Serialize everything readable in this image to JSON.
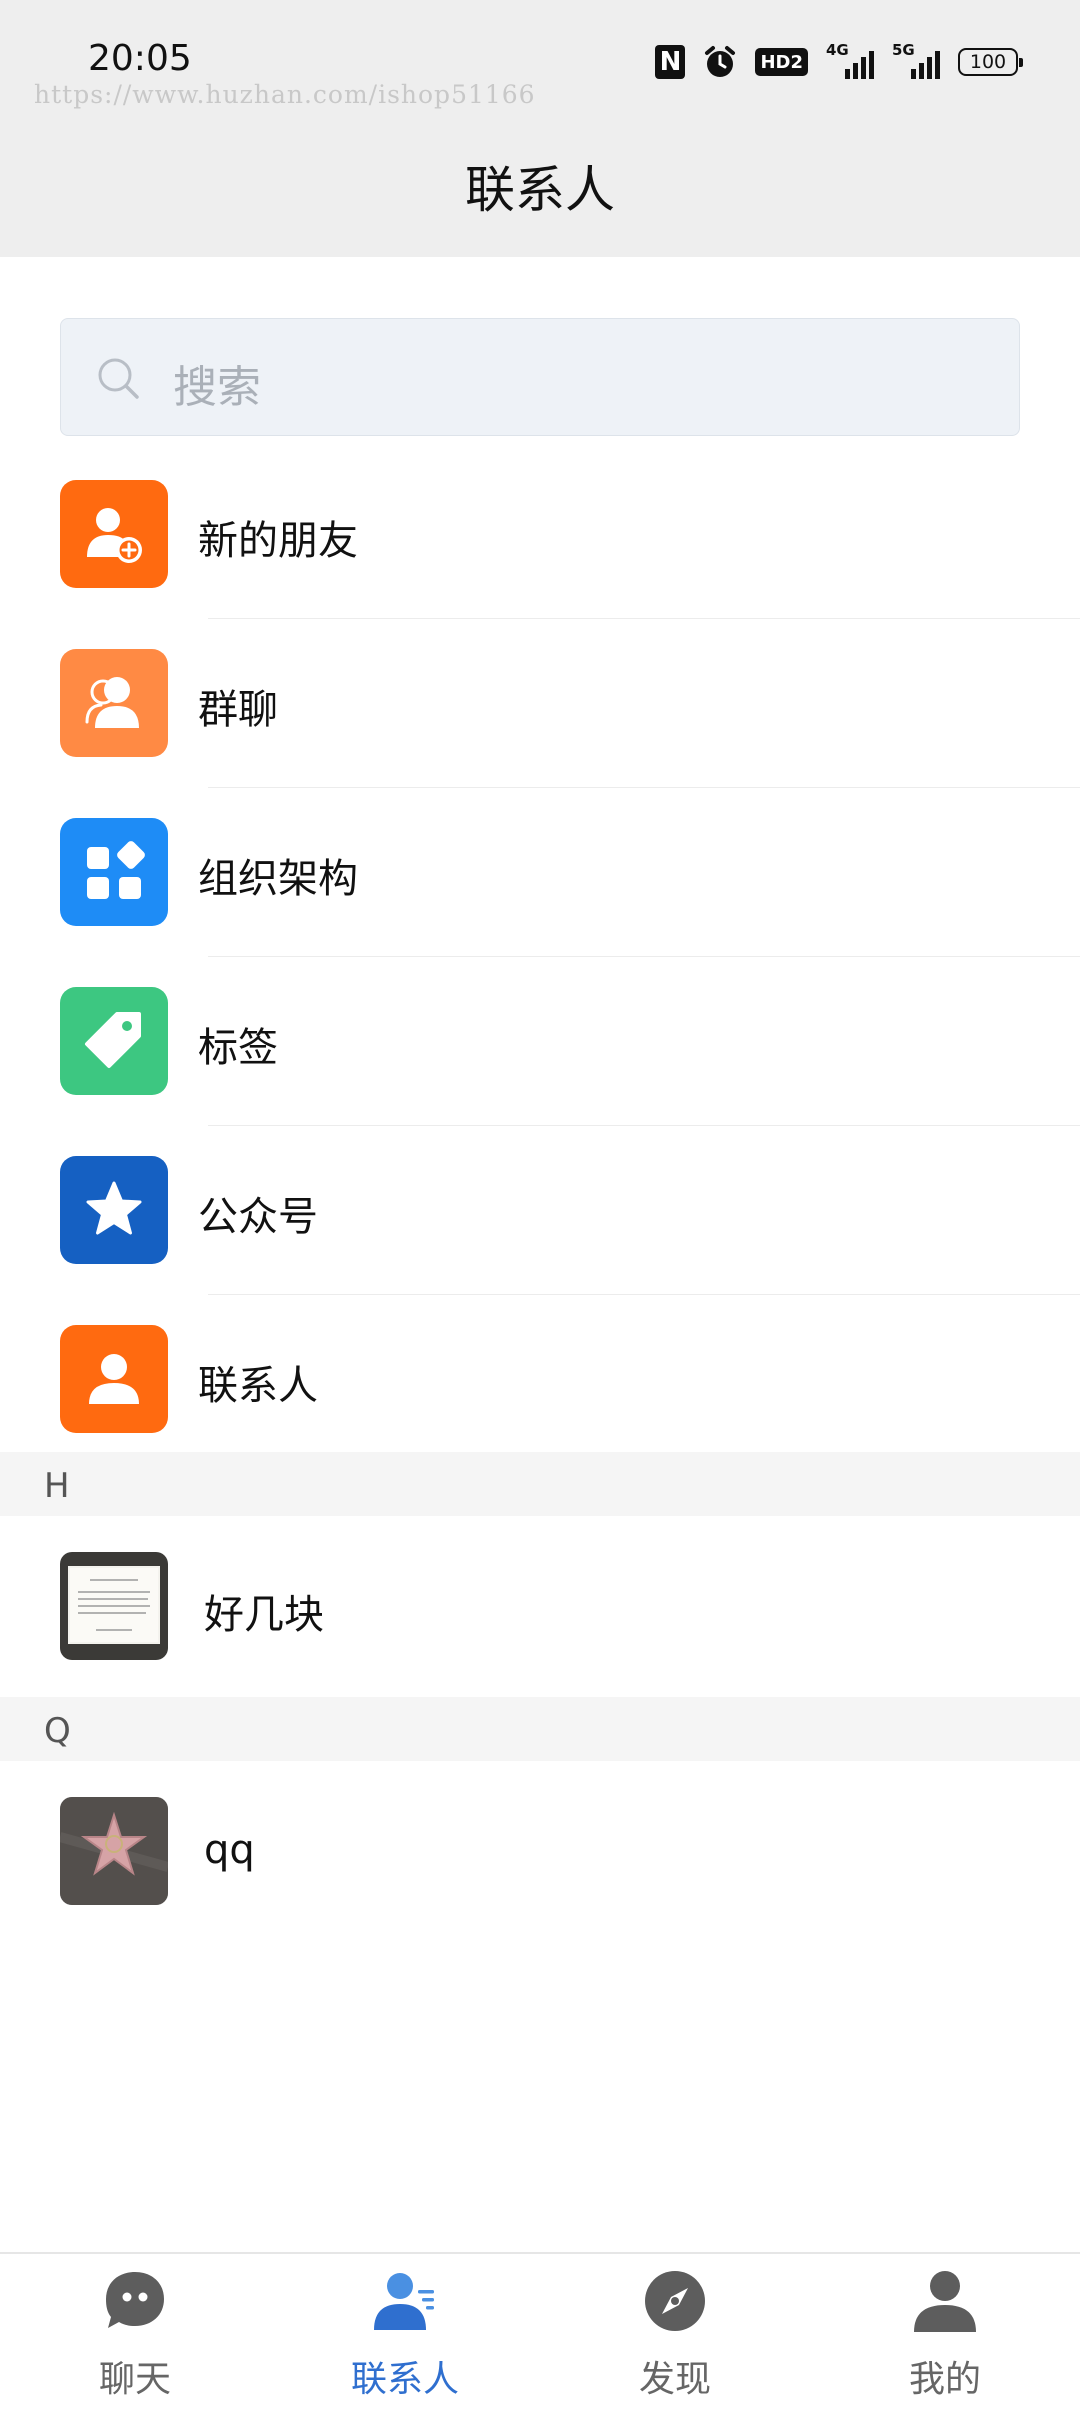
{
  "status_bar": {
    "time": "20:05",
    "watermark": "https://www.huzhan.com/ishop51166",
    "nfc": "N",
    "hd": "HD2",
    "net1": "4G",
    "net2": "5G",
    "battery": "100"
  },
  "header": {
    "title": "联系人"
  },
  "search": {
    "placeholder": "搜索"
  },
  "menu_items": [
    {
      "label": "新的朋友",
      "icon": "add-friend-icon",
      "color": "#ff6a10"
    },
    {
      "label": "群聊",
      "icon": "group-chat-icon",
      "color": "#ff8a44"
    },
    {
      "label": "组织架构",
      "icon": "organization-icon",
      "color": "#1e8cf6"
    },
    {
      "label": "标签",
      "icon": "tag-icon",
      "color": "#3dc781"
    },
    {
      "label": "公众号",
      "icon": "star-icon",
      "color": "#1560c2"
    },
    {
      "label": "联系人",
      "icon": "person-icon",
      "color": "#ff6a10"
    }
  ],
  "sections": [
    {
      "letter": "H",
      "contacts": [
        {
          "name": "好几块"
        }
      ]
    },
    {
      "letter": "Q",
      "contacts": [
        {
          "name": "qq"
        }
      ]
    }
  ],
  "tabbar": {
    "active": 1,
    "active_color": "#2f6fcf",
    "tabs": [
      {
        "label": "聊天",
        "icon": "chat-icon"
      },
      {
        "label": "联系人",
        "icon": "contacts-icon"
      },
      {
        "label": "发现",
        "icon": "compass-icon"
      },
      {
        "label": "我的",
        "icon": "profile-icon"
      }
    ]
  }
}
